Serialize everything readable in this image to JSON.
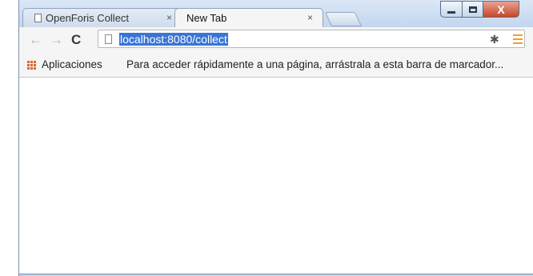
{
  "tabs": [
    {
      "label": "OpenForis Collect",
      "close": "×"
    },
    {
      "label": "New Tab",
      "close": "×"
    }
  ],
  "window_controls": {
    "close_glyph": "X"
  },
  "nav": {
    "back": "←",
    "forward": "→",
    "reload": "C"
  },
  "omnibox": {
    "url": "localhost:8080/collect"
  },
  "toolbar": {
    "extension_icon": "✱"
  },
  "bookmarks": {
    "apps_label": "Aplicaciones",
    "hint": "Para acceder rápidamente a una página, arrástrala a esta barra de marcador..."
  },
  "colors": {
    "url_highlight": "#3875d7",
    "apps_icon": "#e0672a",
    "menu_icon": "#f0a020"
  }
}
